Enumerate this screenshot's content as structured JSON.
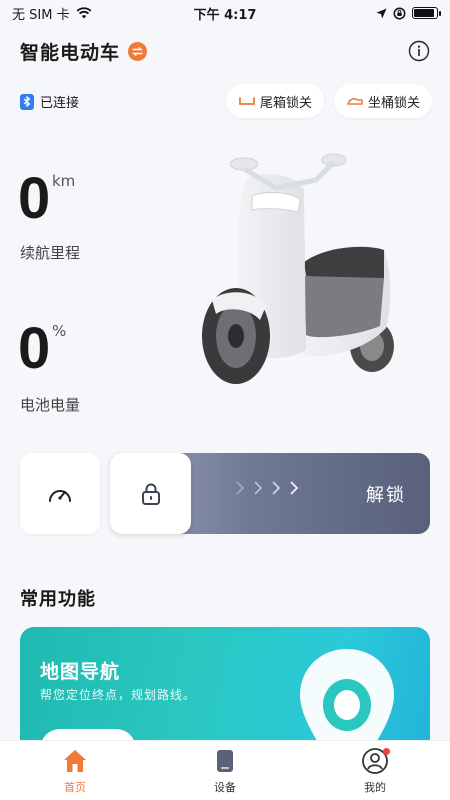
{
  "status_bar": {
    "carrier": "无 SIM 卡",
    "time": "下午 4:17",
    "battery_level": 0.9
  },
  "header": {
    "title": "智能电动车",
    "switch_icon": "swap-icon",
    "info_icon": "info-icon"
  },
  "connection": {
    "status": "已连接",
    "icon": "bluetooth-icon"
  },
  "quick_actions": {
    "trunk_lock": "尾箱锁关",
    "seat_lock": "坐桶锁关"
  },
  "range": {
    "value": "0",
    "unit": "km",
    "label": "续航里程"
  },
  "battery": {
    "value": "0",
    "unit": "%",
    "label": "电池电量"
  },
  "controls": {
    "speed_icon": "speedometer-icon",
    "lock_icon": "lock-icon",
    "unlock_label": "解锁"
  },
  "common_functions": {
    "title": "常用功能",
    "cards": [
      {
        "title": "地图导航",
        "subtitle": "帮您定位终点，规划路线。",
        "icon": "map-pin-icon"
      }
    ]
  },
  "tabbar": {
    "items": [
      {
        "label": "首页",
        "icon": "home-icon",
        "active": true
      },
      {
        "label": "设备",
        "icon": "device-icon",
        "active": false
      },
      {
        "label": "我的",
        "icon": "profile-icon",
        "active": false,
        "badge": true
      }
    ]
  },
  "colors": {
    "accent": "#f07a3a",
    "bluetooth": "#2f7ff0",
    "slider_dark": "#58607b",
    "nav_card": "#2ac7c0"
  }
}
